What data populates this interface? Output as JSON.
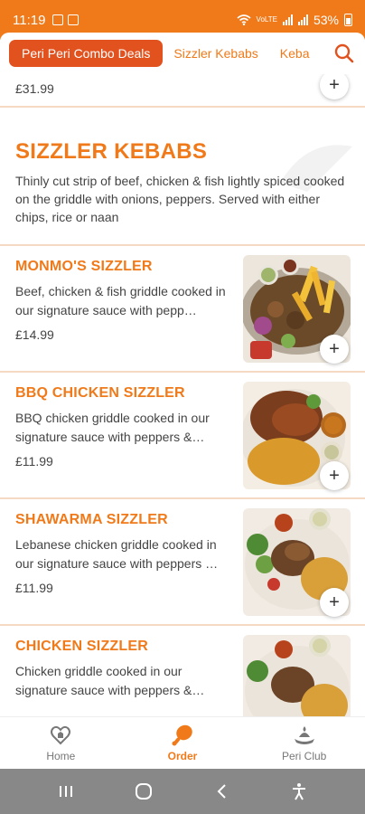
{
  "status_bar": {
    "time": "11:19",
    "network": "VoLTE",
    "battery": "53%"
  },
  "category_tabs": [
    {
      "label": "Peri Peri Combo Deals",
      "active": true
    },
    {
      "label": "Sizzler Kebabs",
      "active": false
    },
    {
      "label": "Keba",
      "active": false
    }
  ],
  "search": {
    "icon": "search-icon"
  },
  "previous_item": {
    "price": "£31.99"
  },
  "section": {
    "title": "SIZZLER KEBABS",
    "description": "Thinly cut strip of beef, chicken & fish lightly spiced cooked on the griddle with onions, peppers. Served with either chips, rice or naan"
  },
  "items": [
    {
      "name": "MONMO'S SIZZLER",
      "description": "Beef, chicken & fish griddle cooked in our signature sauce with pepp…",
      "price": "£14.99"
    },
    {
      "name": "BBQ CHICKEN SIZZLER",
      "description": "BBQ chicken griddle cooked in our signature sauce with peppers &…",
      "price": "£11.99"
    },
    {
      "name": "SHAWARMA SIZZLER",
      "description": "Lebanese chicken griddle cooked in our signature sauce with peppers …",
      "price": "£11.99"
    },
    {
      "name": "CHICKEN SIZZLER",
      "description": "Chicken griddle cooked in our signature sauce with peppers &…",
      "price": ""
    }
  ],
  "add_label": "+",
  "bottom_nav": [
    {
      "label": "Home",
      "icon": "home-heart-icon",
      "active": false
    },
    {
      "label": "Order",
      "icon": "chicken-leg-icon",
      "active": true
    },
    {
      "label": "Peri Club",
      "icon": "club-icon",
      "active": false
    }
  ],
  "colors": {
    "brand_orange": "#f07a1a",
    "active_tab": "#e2521f",
    "separator": "#f5d9c2"
  }
}
